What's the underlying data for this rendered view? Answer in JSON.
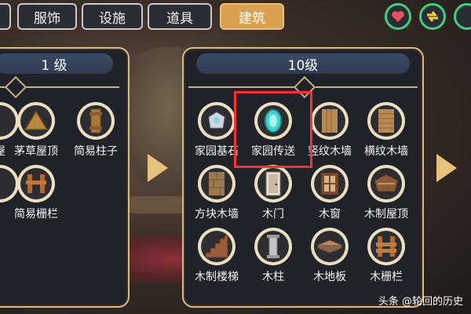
{
  "tabs": [
    {
      "label": "服饰",
      "active": false
    },
    {
      "label": "设施",
      "active": false
    },
    {
      "label": "道具",
      "active": false
    },
    {
      "label": "建筑",
      "active": true
    }
  ],
  "round_buttons": {
    "heart_icon": "heart-icon",
    "swap_icon": "swap-arrows-icon",
    "third_icon": "partial"
  },
  "left_panel": {
    "level_label": "1 级",
    "items": [
      {
        "label": "屋",
        "icon": "partial-item-icon"
      },
      {
        "label": "茅草屋顶",
        "icon": "thatch-roof-icon"
      },
      {
        "label": "简易柱子",
        "icon": "simple-pillar-icon"
      },
      {
        "label": "",
        "icon": "partial-item-icon"
      },
      {
        "label": "简易栅栏",
        "icon": "simple-fence-icon"
      }
    ]
  },
  "right_panel": {
    "level_label": "10级",
    "items": [
      {
        "label": "家园基石",
        "icon": "home-cornerstone-icon"
      },
      {
        "label": "家园传送",
        "icon": "home-teleport-icon",
        "selected": true
      },
      {
        "label": "竖纹木墙",
        "icon": "vertical-wood-wall-icon"
      },
      {
        "label": "横纹木墙",
        "icon": "horizontal-wood-wall-icon"
      },
      {
        "label": "方块木墙",
        "icon": "block-wood-wall-icon"
      },
      {
        "label": "木门",
        "icon": "wooden-door-icon"
      },
      {
        "label": "木窗",
        "icon": "wooden-window-icon"
      },
      {
        "label": "木制屋顶",
        "icon": "wooden-roof-icon"
      },
      {
        "label": "木制楼梯",
        "icon": "wooden-stairs-icon"
      },
      {
        "label": "木柱",
        "icon": "wooden-pillar-icon"
      },
      {
        "label": "木地板",
        "icon": "wooden-floor-icon"
      },
      {
        "label": "木栅栏",
        "icon": "wooden-fence-icon"
      }
    ]
  },
  "watermark": "头条 @轮回的历史",
  "colors": {
    "accent": "#d9a050",
    "highlight": "#ff2d2d",
    "green_ring": "#3fd07f"
  }
}
